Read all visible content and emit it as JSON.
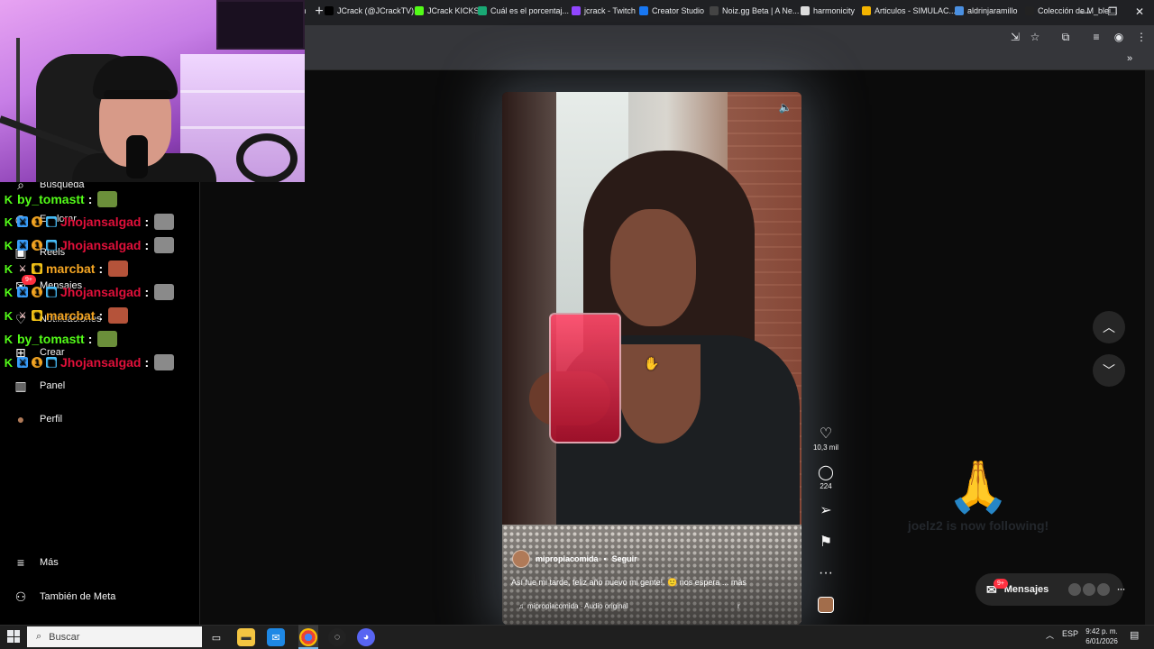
{
  "browser": {
    "new_tab_symbol": "+",
    "window_controls": {
      "minimize": "—",
      "restore": "❐",
      "close": "✕"
    },
    "bookmarks": [
      {
        "label": "ch",
        "color": "#202124"
      },
      {
        "label": "JCrack (@JCrackTV)...",
        "color": "#000000"
      },
      {
        "label": "JCrack KICKS",
        "color": "#53fc18"
      },
      {
        "label": "Cuál es el porcentaj...",
        "color": "#19a974"
      },
      {
        "label": "jcrack - Twitch",
        "color": "#9146ff"
      },
      {
        "label": "Creator Studio",
        "color": "#1877f2"
      },
      {
        "label": "Noiz.gg Beta | A Ne...",
        "color": "#444444"
      },
      {
        "label": "harmonicity",
        "color": "#dddddd"
      },
      {
        "label": "Articulos - SIMULAC...",
        "color": "#f4b400"
      },
      {
        "label": "aldrinjaramillo",
        "color": "#4a90e2"
      },
      {
        "label": "Colección de M_blei...",
        "color": "#222222"
      }
    ],
    "bookmarks_more": "»"
  },
  "sidebar": {
    "items": [
      {
        "label": "Búsqueda",
        "icon": "search-icon",
        "glyph": "⌕"
      },
      {
        "label": "Explorar",
        "icon": "compass-icon",
        "glyph": "◎"
      },
      {
        "label": "Reels",
        "icon": "reels-icon",
        "glyph": "▣"
      },
      {
        "label": "Mensajes",
        "icon": "messenger-icon",
        "glyph": "✉"
      },
      {
        "label": "Notificaciones",
        "icon": "heart-icon",
        "glyph": "♡"
      },
      {
        "label": "Crear",
        "icon": "plus-square-icon",
        "glyph": "⊞"
      },
      {
        "label": "Panel",
        "icon": "chart-icon",
        "glyph": "▥"
      },
      {
        "label": "Perfil",
        "icon": "profile-avatar",
        "glyph": "●"
      }
    ],
    "more_label": "Más",
    "more_glyph": "≡",
    "meta_label": "También de Meta",
    "meta_glyph": "⚇",
    "messages_badge": "9+"
  },
  "chat": [
    {
      "user": "by_tomastt",
      "color": "#53fc18",
      "badges": [
        "k"
      ],
      "emote": "#6b8f3a"
    },
    {
      "user": "Jhojansalgad",
      "color": "#e0103a",
      "badges": [
        "k",
        "swords",
        "one",
        "grid"
      ],
      "emote": "#8a8a8a"
    },
    {
      "user": "Jhojansalgad",
      "color": "#e0103a",
      "badges": [
        "k",
        "swords",
        "one",
        "grid"
      ],
      "emote": "#8a8a8a"
    },
    {
      "user": "marcbat",
      "color": "#f5a623",
      "badges": [
        "k",
        "mod",
        "crown"
      ],
      "emote": "#b5533a"
    },
    {
      "user": "Jhojansalgad",
      "color": "#e0103a",
      "badges": [
        "k",
        "swords",
        "one",
        "grid"
      ],
      "emote": "#8a8a8a"
    },
    {
      "user": "marcbat",
      "color": "#f5a623",
      "badges": [
        "k",
        "mod",
        "crown"
      ],
      "emote": "#b5533a"
    },
    {
      "user": "by_tomastt",
      "color": "#53fc18",
      "badges": [
        "k"
      ],
      "emote": "#6b8f3a"
    },
    {
      "user": "Jhojansalgad",
      "color": "#e0103a",
      "badges": [
        "k",
        "swords",
        "one",
        "grid"
      ],
      "emote": "#8a8a8a"
    }
  ],
  "reel": {
    "username": "mipropiacomida",
    "separator": "•",
    "follow_label": "Seguir",
    "caption": "Así fue mi tarde, feliz año nuevo mi gente!. 🙂 nos espera ... más",
    "audio": "mipropiacomida · Audio original",
    "audio_tag": "r",
    "sound_icon": "🔈"
  },
  "actions": {
    "likes": "10,3 mil",
    "comments": "224",
    "like_glyph": "♡",
    "comment_glyph": "◯",
    "share_glyph": "➢",
    "save_glyph": "⚑",
    "more_glyph": "···"
  },
  "navigation": {
    "up_glyph": "︿",
    "down_glyph": "﹀"
  },
  "follow_overlay": {
    "text": "joelz2 is now following!",
    "glyph": "🙏"
  },
  "messages_pill": {
    "label": "Mensajes",
    "badge": "9+",
    "more": "···"
  },
  "taskbar": {
    "search_placeholder": "Buscar",
    "language": "ESP",
    "time": "9:42 p. m.",
    "date": "6/01/2026"
  }
}
